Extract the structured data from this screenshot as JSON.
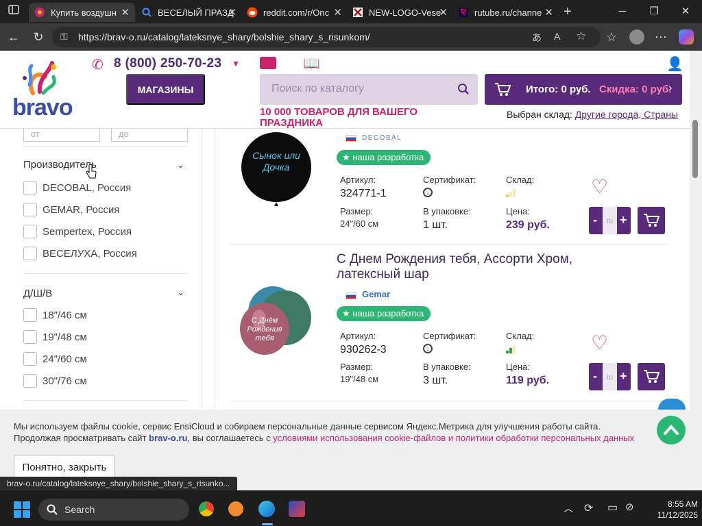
{
  "tabs": [
    {
      "title": "Купить воздушн",
      "active": true
    },
    {
      "title": "ВЕСЕЛЫЙ ПРАЗД",
      "active": false
    },
    {
      "title": "reddit.com/r/Onc",
      "active": false
    },
    {
      "title": "NEW-LOGO-Vese",
      "active": false
    },
    {
      "title": "rutube.ru/channe",
      "active": false
    }
  ],
  "browser": {
    "url": "https://brav-o.ru/catalog/lateksnye_shary/bolshie_shary_s_risunkom/",
    "status_url": "brav-o.ru/catalog/lateksnye_shary/bolshie_shary_s_risunko..."
  },
  "site": {
    "logo_text": "bravo",
    "phone": "8 (800) 250-70-23",
    "stores_button": "МАГАЗИНЫ",
    "search_placeholder": "Поиск по каталогу",
    "cart_total": "Итого: 0 руб.",
    "cart_discount": "Скидка: 0 руб.",
    "tagline": "10 000 ТОВАРОВ ДЛЯ ВАШЕГО ПРАЗДНИКА",
    "warehouse_label": "Выбран склад:",
    "warehouse_value": "Другие города, Страны"
  },
  "sidebar": {
    "range_from": "от",
    "range_to": "до",
    "manufacturer_title": "Производитель",
    "manufacturers": [
      "DECOBAL, Россия",
      "GEMAR, Россия",
      "Sempertex, Россия",
      "ВЕСЕЛУХА, Россия"
    ],
    "size_title": "Д/Ш/В",
    "sizes": [
      "18\"/46 см",
      "19\"/48 см",
      "24\"/60 см",
      "30\"/76 см"
    ]
  },
  "labels": {
    "article": "Артикул:",
    "certificate": "Сертификат:",
    "stock": "Склад:",
    "size": "Размер:",
    "pack": "В упаковке:",
    "price": "Цена:",
    "badge": "наша разработка",
    "qty_placeholder": "ш"
  },
  "products": [
    {
      "name": "",
      "brand": "DECOBAL",
      "balloon_text": "Сынок или Дочка",
      "article": "324771-1",
      "size": "24\"/60 см",
      "pack": "1 шт.",
      "price": "239 руб.",
      "stock_level": 0.33,
      "stock_color": "#e8d44a"
    },
    {
      "name": "С Днем Рождения тебя, Ассорти Хром, латексный шар",
      "brand": "Gemar",
      "balloon_text": "С Днём Рождения тебя",
      "article": "930262-3",
      "size": "19\"/48 см",
      "pack": "3 шт.",
      "price": "119 руб.",
      "stock_level": 0.67,
      "stock_color": "#2ba84a"
    }
  ],
  "cookie": {
    "line1": "Мы используем файлы cookie, сервис EnsiCloud и собираем персональные данные сервисом Яндекс.Метрика для улучшения работы сайта.",
    "line2_start": "Продолжая просматривать сайт ",
    "line2_site": "brav-o.ru",
    "line2_mid": ", вы соглашаетесь с ",
    "line2_link": "условиями использования cookie-файлов и политики обработки персональных данных",
    "button": "Понятно, закрыть"
  },
  "taskbar": {
    "search": "Search",
    "time": "8:55 AM",
    "date": "11/12/2025"
  },
  "colors": {
    "brand_purple": "#5a2a7a",
    "accent_pink": "#c8246c",
    "badge_green": "#2bb673"
  }
}
